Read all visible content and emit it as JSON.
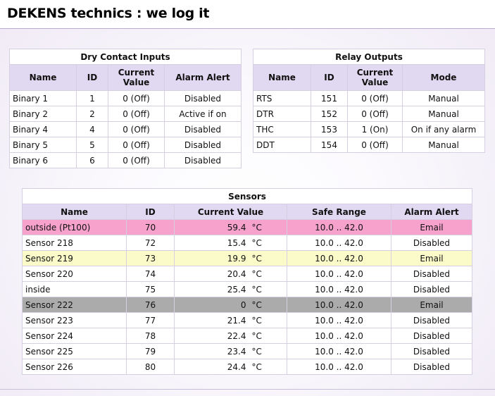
{
  "header": {
    "title": "DEKENS technics : we log it"
  },
  "dry_contact": {
    "caption": "Dry Contact Inputs",
    "columns": [
      "Name",
      "ID",
      "Current Value",
      "Alarm Alert"
    ],
    "rows": [
      {
        "name": "Binary 1",
        "id": "1",
        "value": "0 (Off)",
        "alert": "Disabled"
      },
      {
        "name": "Binary 2",
        "id": "2",
        "value": "0 (Off)",
        "alert": "Active if on"
      },
      {
        "name": "Binary 4",
        "id": "4",
        "value": "0 (Off)",
        "alert": "Disabled"
      },
      {
        "name": "Binary 5",
        "id": "5",
        "value": "0 (Off)",
        "alert": "Disabled"
      },
      {
        "name": "Binary 6",
        "id": "6",
        "value": "0 (Off)",
        "alert": "Disabled"
      }
    ]
  },
  "relay": {
    "caption": "Relay Outputs",
    "columns": [
      "Name",
      "ID",
      "Current Value",
      "Mode"
    ],
    "rows": [
      {
        "name": "RTS",
        "id": "151",
        "value": "0 (Off)",
        "mode": "Manual"
      },
      {
        "name": "DTR",
        "id": "152",
        "value": "0 (Off)",
        "mode": "Manual"
      },
      {
        "name": "THC",
        "id": "153",
        "value": "1 (On)",
        "mode": "On if any alarm"
      },
      {
        "name": "DDT",
        "id": "154",
        "value": "0 (Off)",
        "mode": "Manual"
      }
    ]
  },
  "sensors": {
    "caption": "Sensors",
    "columns": [
      "Name",
      "ID",
      "Current Value",
      "Safe Range",
      "Alarm Alert"
    ],
    "rows": [
      {
        "name": "outside (Pt100)",
        "id": "70",
        "value": "59.4",
        "unit": "°C",
        "range": "10.0 .. 42.0",
        "alert": "Email",
        "row_color": "#f6a2cc"
      },
      {
        "name": "Sensor 218",
        "id": "72",
        "value": "15.4",
        "unit": "°C",
        "range": "10.0 .. 42.0",
        "alert": "Disabled"
      },
      {
        "name": "Sensor 219",
        "id": "73",
        "value": "19.9",
        "unit": "°C",
        "range": "10.0 .. 42.0",
        "alert": "Email",
        "row_color": "#fafbc9"
      },
      {
        "name": "Sensor 220",
        "id": "74",
        "value": "20.4",
        "unit": "°C",
        "range": "10.0 .. 42.0",
        "alert": "Disabled"
      },
      {
        "name": "inside",
        "id": "75",
        "value": "25.4",
        "unit": "°C",
        "range": "10.0 .. 42.0",
        "alert": "Disabled"
      },
      {
        "name": "Sensor 222",
        "id": "76",
        "value": "0",
        "unit": "°C",
        "range": "10.0 .. 42.0",
        "alert": "Email",
        "row_color": "#ababab"
      },
      {
        "name": "Sensor 223",
        "id": "77",
        "value": "21.4",
        "unit": "°C",
        "range": "10.0 .. 42.0",
        "alert": "Disabled"
      },
      {
        "name": "Sensor 224",
        "id": "78",
        "value": "22.4",
        "unit": "°C",
        "range": "10.0 .. 42.0",
        "alert": "Disabled"
      },
      {
        "name": "Sensor 225",
        "id": "79",
        "value": "23.4",
        "unit": "°C",
        "range": "10.0 .. 42.0",
        "alert": "Disabled"
      },
      {
        "name": "Sensor 226",
        "id": "80",
        "value": "24.4",
        "unit": "°C",
        "range": "10.0 .. 42.0",
        "alert": "Disabled"
      }
    ]
  }
}
